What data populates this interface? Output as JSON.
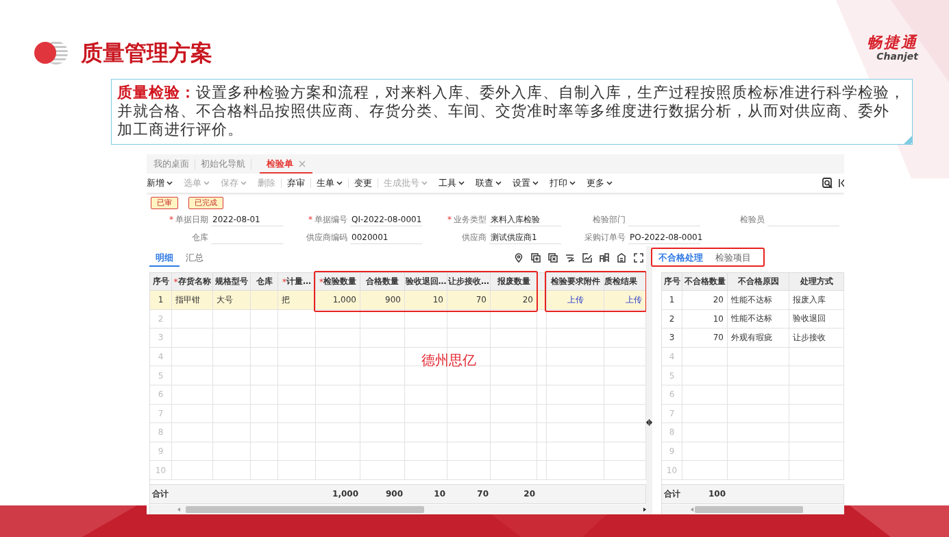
{
  "slide": {
    "title": "质量管理方案",
    "brand": {
      "name": "畅捷通",
      "latin": "Chanjet"
    },
    "callout_lines": [
      "**质量检验：**设置多种检验方案和流程，对来料入库、委外入库、自制入库，生产过程按照质检标准进行科学检验，",
      "并就合格、不合格料品按照供应商、存货分类、车间、交货准时率等多维度进行数据分析，从而对供应商、委外",
      "加工商进行评价。"
    ]
  },
  "app": {
    "tabs": [
      {
        "label": "我的桌面",
        "selected": false,
        "closable": false
      },
      {
        "label": "初始化导航",
        "selected": false,
        "closable": false
      },
      {
        "label": "检验单",
        "selected": true,
        "closable": true
      }
    ],
    "toolbar": [
      {
        "label": "新增",
        "dropdown": true,
        "disabled": false,
        "divider": false
      },
      {
        "label": "选单",
        "dropdown": true,
        "disabled": true,
        "divider": false
      },
      {
        "label": "保存",
        "dropdown": true,
        "disabled": true,
        "divider": false
      },
      {
        "label": "删除",
        "dropdown": false,
        "disabled": true,
        "divider": false
      },
      {
        "label": "弃审",
        "dropdown": false,
        "disabled": false,
        "divider": true
      },
      {
        "label": "生单",
        "dropdown": true,
        "disabled": false,
        "divider": true
      },
      {
        "label": "变更",
        "dropdown": false,
        "disabled": false,
        "divider": true
      },
      {
        "label": "生成批号",
        "dropdown": true,
        "disabled": true,
        "divider": true
      },
      {
        "label": "工具",
        "dropdown": true,
        "disabled": false,
        "divider": false
      },
      {
        "label": "联查",
        "dropdown": true,
        "disabled": false,
        "divider": false
      },
      {
        "label": "设置",
        "dropdown": true,
        "disabled": false,
        "divider": false
      },
      {
        "label": "打印",
        "dropdown": true,
        "disabled": false,
        "divider": false
      },
      {
        "label": "更多",
        "dropdown": true,
        "disabled": false,
        "divider": false
      }
    ],
    "statuses": [
      "已审",
      "已完成"
    ],
    "form": [
      {
        "label": "单据日期",
        "marker": "*",
        "value": "2022-08-01"
      },
      {
        "label": "单据编号",
        "marker": "*",
        "value": "QI-2022-08-0001"
      },
      {
        "label": "业务类型",
        "marker": "*",
        "value": "来料入库检验"
      },
      {
        "label": "检验部门"
      },
      {
        "label": "检验员"
      },
      {
        "label": "仓库"
      },
      {
        "label": "供应商编码",
        "value": "0020001"
      },
      {
        "label": "供应商",
        "value": "测试供应商1"
      },
      {
        "label": "采购订单号",
        "value": "PO-2022-08-0001"
      }
    ],
    "detail_tabs": [
      {
        "label": "明细",
        "selected": true
      },
      {
        "label": "汇总",
        "selected": false
      }
    ],
    "side_tabs": {
      "boxed": true,
      "tabs": [
        {
          "label": "不合格处理",
          "selected": true
        },
        {
          "label": "检验项目",
          "selected": false
        }
      ]
    },
    "grid": {
      "total_label": "合计",
      "columns": [
        {
          "label": "序号",
          "kind": "index",
          "boxed": false
        },
        {
          "label": "存货名称",
          "marker": "*",
          "kind": "text",
          "boxed": false
        },
        {
          "label": "规格型号",
          "kind": "text",
          "boxed": false
        },
        {
          "label": "仓库",
          "kind": "text",
          "boxed": false
        },
        {
          "label": "计量…",
          "marker": "*",
          "kind": "text",
          "boxed": false
        },
        {
          "label": "检验数量",
          "marker": "*",
          "kind": "number",
          "boxed": true,
          "total": "1,000"
        },
        {
          "label": "合格数量",
          "kind": "number",
          "boxed": true,
          "total": "900"
        },
        {
          "label": "验收退回…",
          "kind": "number",
          "boxed": true,
          "total": "10"
        },
        {
          "label": "让步接收…",
          "kind": "number",
          "boxed": true,
          "total": "70"
        },
        {
          "label": "报废数量",
          "kind": "number",
          "boxed": true,
          "total": "20"
        },
        {
          "kind": "text",
          "boxed": false
        },
        {
          "label": "检验要求附件",
          "kind": "link",
          "boxed": true
        },
        {
          "label": "质检结果",
          "kind": "link",
          "boxed": true
        }
      ],
      "rows": [
        {
          "selected": true,
          "cells": [
            "1",
            "指甲钳",
            "大号",
            null,
            "把",
            "1,000",
            "900",
            "10",
            "70",
            "20",
            null,
            "上传",
            "上传"
          ]
        },
        {
          "selected": false,
          "cells": [
            "2"
          ]
        },
        {
          "selected": false,
          "cells": [
            "3"
          ]
        },
        {
          "selected": false,
          "cells": [
            "4"
          ]
        },
        {
          "selected": false,
          "cells": [
            "5"
          ]
        },
        {
          "selected": false,
          "cells": [
            "6"
          ]
        },
        {
          "selected": false,
          "cells": [
            "7"
          ]
        },
        {
          "selected": false,
          "cells": [
            "8"
          ]
        },
        {
          "selected": false,
          "cells": [
            "9"
          ]
        },
        {
          "selected": false,
          "cells": [
            "10"
          ]
        }
      ]
    },
    "side_grid": {
      "total_label": "合计",
      "columns": [
        {
          "label": "序号",
          "kind": "index"
        },
        {
          "label": "不合格数量",
          "kind": "number",
          "total": "100"
        },
        {
          "label": "不合格原因",
          "kind": "text"
        },
        {
          "label": "处理方式",
          "kind": "text"
        }
      ],
      "rows": [
        {
          "selected": false,
          "cells": [
            "1",
            "20",
            "性能不达标",
            "报废入库"
          ]
        },
        {
          "selected": false,
          "cells": [
            "2",
            "10",
            "性能不达标",
            "验收退回"
          ]
        },
        {
          "selected": false,
          "cells": [
            "3",
            "70",
            "外观有瑕疵",
            "让步接收"
          ]
        },
        {
          "selected": false,
          "cells": [
            "4"
          ]
        },
        {
          "selected": false,
          "cells": [
            "5"
          ]
        },
        {
          "selected": false,
          "cells": [
            "6"
          ]
        },
        {
          "selected": false,
          "cells": [
            "7"
          ]
        },
        {
          "selected": false,
          "cells": [
            "8"
          ]
        },
        {
          "selected": false,
          "cells": [
            "9"
          ]
        },
        {
          "selected": false,
          "cells": [
            "10"
          ]
        }
      ]
    }
  },
  "annotation": "德州思亿"
}
